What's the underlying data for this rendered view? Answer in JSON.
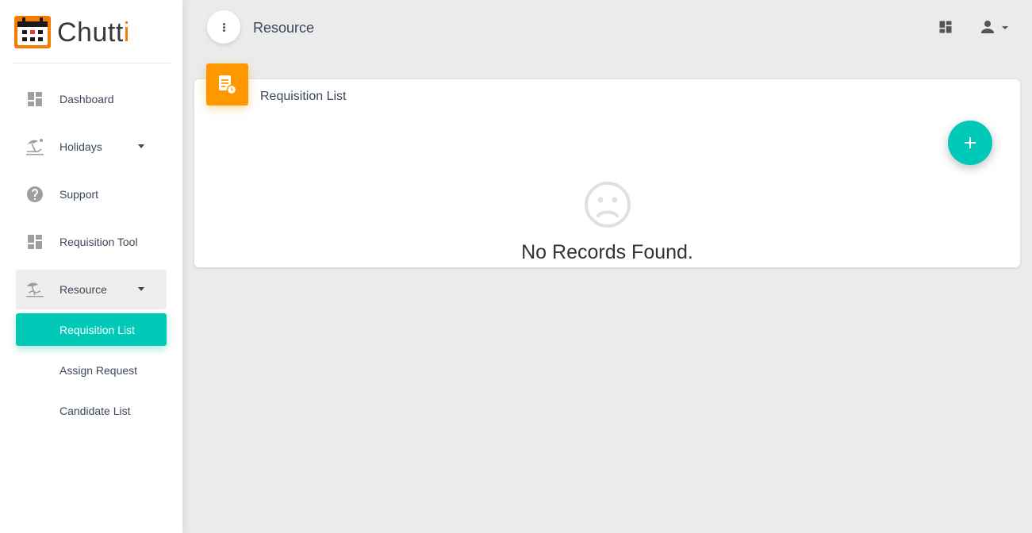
{
  "app": {
    "logo_text_main": "Chutt",
    "logo_text_accent": "i",
    "brand_color": "#f57c00",
    "accent_color": "#00c9b7",
    "card_icon_color": "#ff9800"
  },
  "sidebar": {
    "items": [
      {
        "label": "Dashboard",
        "icon": "dashboard-icon"
      },
      {
        "label": "Holidays",
        "icon": "beach-icon",
        "has_caret": true
      },
      {
        "label": "Support",
        "icon": "help-icon"
      },
      {
        "label": "Requisition Tool",
        "icon": "dashboard-icon"
      },
      {
        "label": "Resource",
        "icon": "beach-icon",
        "has_caret": true,
        "expanded": true
      }
    ],
    "subitems": [
      {
        "label": "Requisition List",
        "active": true
      },
      {
        "label": "Assign Request"
      },
      {
        "label": "Candidate List"
      }
    ]
  },
  "header": {
    "title": "Resource"
  },
  "card": {
    "title": "Requisition List",
    "empty_message": "No Records Found."
  }
}
